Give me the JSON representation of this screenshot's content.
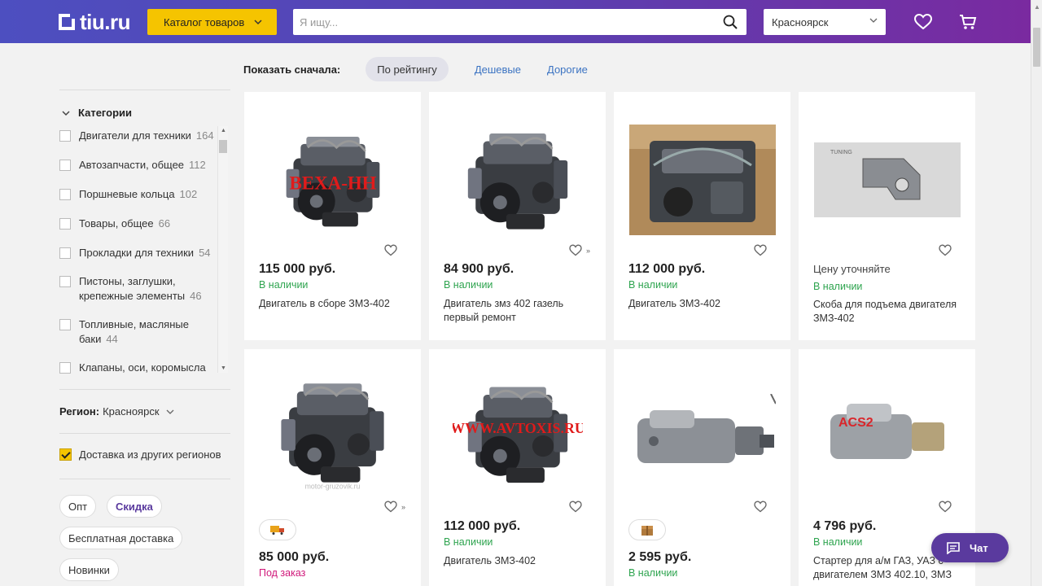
{
  "header": {
    "logo": "tiu.ru",
    "catalog_label": "Каталог товаров",
    "search_placeholder": "Я ищу...",
    "region": "Красноярск"
  },
  "sidebar": {
    "categories_title": "Категории",
    "categories": [
      {
        "label": "Двигатели для техники",
        "count": "164"
      },
      {
        "label": "Автозапчасти, общее",
        "count": "112"
      },
      {
        "label": "Поршневые кольца",
        "count": "102"
      },
      {
        "label": "Товары, общее",
        "count": "66"
      },
      {
        "label": "Прокладки для техники",
        "count": "54"
      },
      {
        "label": "Пистоны, заглушки, крепежные элементы",
        "count": "46"
      },
      {
        "label": "Топливные, масляные баки",
        "count": "44"
      },
      {
        "label": "Клапаны, оси, коромысла",
        "count": ""
      }
    ],
    "region_label": "Регион:",
    "region_value": "Красноярск",
    "delivery_label": "Доставка из других регионов",
    "chips": [
      "Опт",
      "Скидка",
      "Бесплатная доставка",
      "Новинки"
    ]
  },
  "sort": {
    "label": "Показать сначала:",
    "options": [
      "По рейтингу",
      "Дешевые",
      "Дорогие"
    ]
  },
  "products": [
    {
      "price": "115 000 руб.",
      "status": "В наличии",
      "title": "Двигатель в сборе ЗМЗ-402",
      "watermark": "ВЕХА-НН"
    },
    {
      "price": "84 900 руб.",
      "status": "В наличии",
      "title": "Двигатель змз 402 газель первый ремонт"
    },
    {
      "price": "112 000 руб.",
      "status": "В наличии",
      "title": "Двигатель ЗМЗ-402"
    },
    {
      "price_note": "Цену уточняйте",
      "status": "В наличии",
      "title": "Скоба для подъема двигателя ЗМЗ-402",
      "watermark": "TUNING"
    },
    {
      "price": "85 000 руб.",
      "status": "Под заказ",
      "title": "",
      "watermark": "motor-gruzovik.ru"
    },
    {
      "price": "112 000 руб.",
      "status": "В наличии",
      "title": "Двигатель ЗМЗ-402",
      "watermark": "WWW.AVTOXIS.RU"
    },
    {
      "price": "2 595 руб.",
      "status": "В наличии",
      "title": ""
    },
    {
      "price": "4 796 руб.",
      "status": "В наличии",
      "title": "Стартер для а/м ГАЗ, УАЗ с двигателем ЗМЗ 402.10, ЗМЗ",
      "watermark": "ACS2"
    }
  ],
  "chat_label": "Чат",
  "colors": {
    "header_start": "#4d4fc0",
    "header_end": "#7a2aa0",
    "catalog_button": "#f5c400",
    "in_stock": "#2ea44f",
    "on_order": "#d0187a",
    "link": "#3b73c2",
    "chat": "#5a3a9e"
  }
}
